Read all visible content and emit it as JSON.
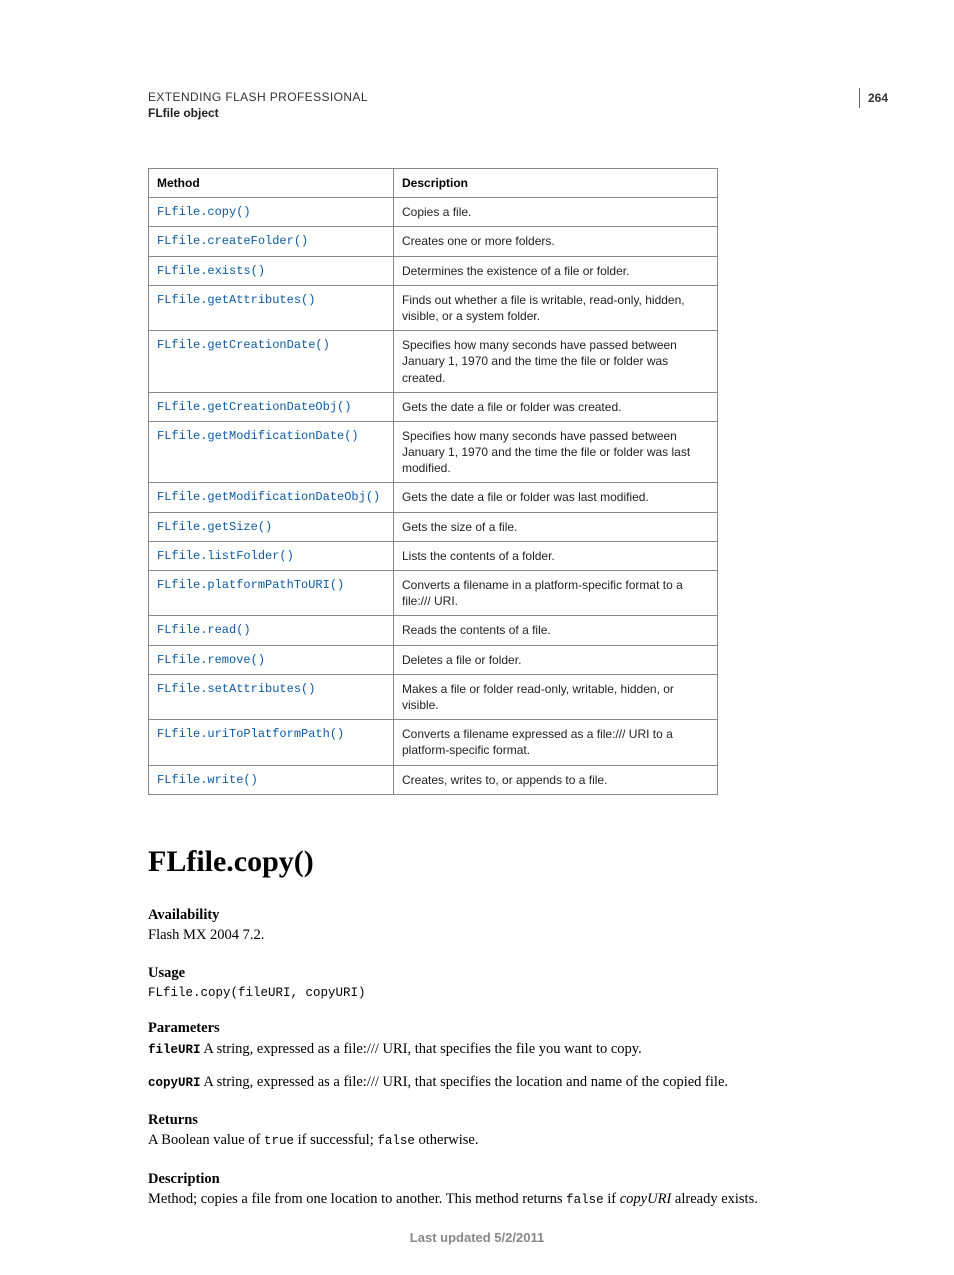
{
  "page_number": "264",
  "header": {
    "title": "EXTENDING FLASH PROFESSIONAL",
    "subtitle": "FLfile object"
  },
  "table": {
    "headers": {
      "method": "Method",
      "description": "Description"
    },
    "rows": [
      {
        "method": "FLfile.copy()",
        "desc": "Copies a file."
      },
      {
        "method": "FLfile.createFolder()",
        "desc": "Creates one or more folders."
      },
      {
        "method": "FLfile.exists()",
        "desc": "Determines the existence of a file or folder."
      },
      {
        "method": "FLfile.getAttributes()",
        "desc": "Finds out whether a file is writable, read-only, hidden, visible, or a system folder."
      },
      {
        "method": "FLfile.getCreationDate()",
        "desc": "Specifies how many seconds have passed between January 1, 1970 and the time the file or folder was created."
      },
      {
        "method": "FLfile.getCreationDateObj()",
        "desc": "Gets the date a file or folder was created."
      },
      {
        "method": "FLfile.getModificationDate()",
        "desc": "Specifies how many seconds have passed between January 1, 1970 and the time the file or folder was last modified."
      },
      {
        "method": "FLfile.getModificationDateObj()",
        "desc": "Gets the date a file or folder was last modified."
      },
      {
        "method": "FLfile.getSize()",
        "desc": "Gets the size of a file."
      },
      {
        "method": "FLfile.listFolder()",
        "desc": "Lists the contents of a folder."
      },
      {
        "method": "FLfile.platformPathToURI()",
        "desc": "Converts a filename in a platform-specific format to a file:/// URI."
      },
      {
        "method": "FLfile.read()",
        "desc": "Reads the contents of a file."
      },
      {
        "method": "FLfile.remove()",
        "desc": "Deletes a file or folder."
      },
      {
        "method": "FLfile.setAttributes()",
        "desc": "Makes a file or folder read-only, writable, hidden, or visible."
      },
      {
        "method": "FLfile.uriToPlatformPath()",
        "desc": "Converts a filename expressed as a file:/// URI to a platform-specific format."
      },
      {
        "method": "FLfile.write()",
        "desc": "Creates, writes to, or appends to a file."
      }
    ]
  },
  "section": {
    "title": "FLfile.copy()",
    "availability": {
      "head": "Availability",
      "text": "Flash MX 2004 7.2."
    },
    "usage": {
      "head": "Usage",
      "code": "FLfile.copy(fileURI, copyURI)"
    },
    "parameters": {
      "head": "Parameters",
      "p1_name": "fileURI",
      "p1_text": "  A string, expressed as a file:/// URI, that specifies the file you want to copy.",
      "p2_name": "copyURI",
      "p2_text": "  A string, expressed as a file:/// URI, that specifies the location and name of the copied file."
    },
    "returns": {
      "head": "Returns",
      "pre": "A Boolean value of ",
      "true": "true",
      "mid": " if successful; ",
      "false": "false",
      "post": " otherwise."
    },
    "description": {
      "head": "Description",
      "pre": "Method; copies a file from one location to another. This method returns ",
      "false": "false",
      "mid": " if ",
      "copyuri": "copyURI",
      "post": " already exists."
    }
  },
  "footer": "Last updated 5/2/2011"
}
